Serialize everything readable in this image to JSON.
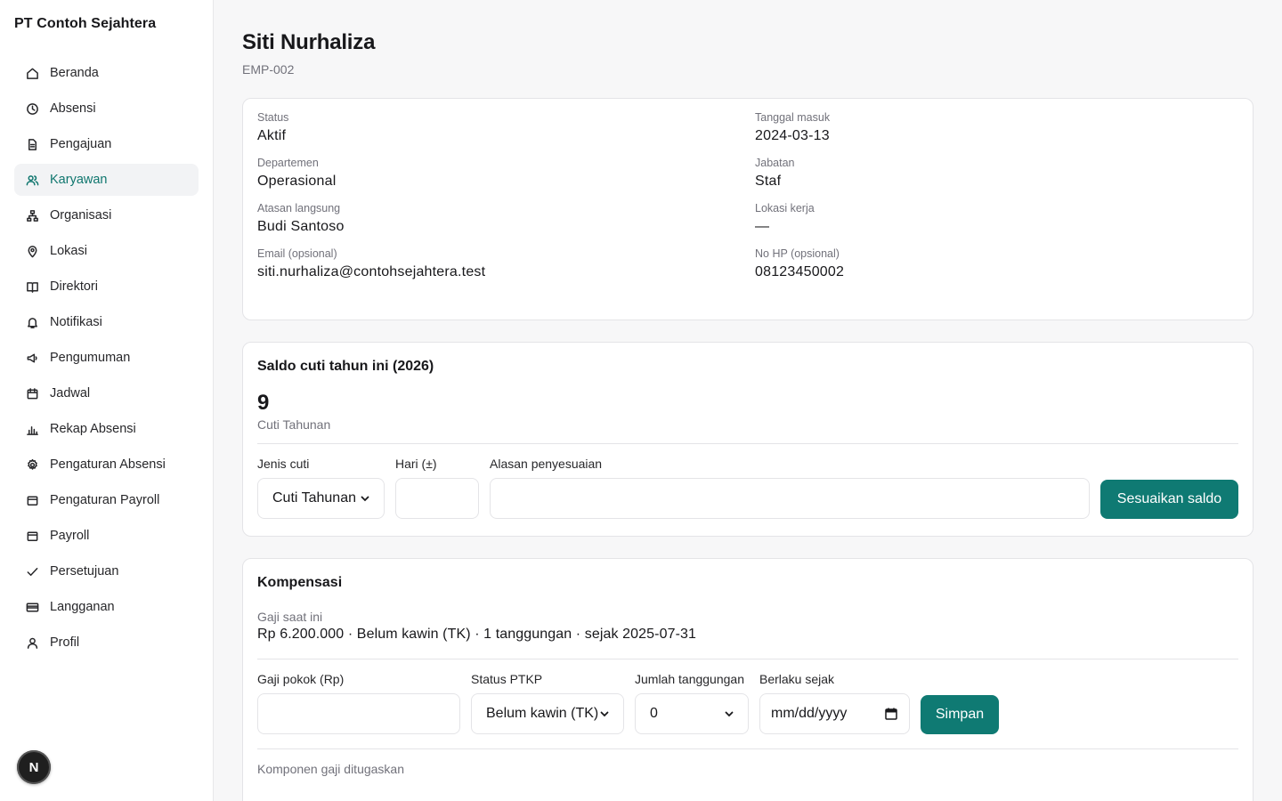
{
  "sidebar": {
    "company": "PT Contoh Sejahtera",
    "items": [
      {
        "label": "Beranda",
        "icon": "home-icon"
      },
      {
        "label": "Absensi",
        "icon": "clock-icon"
      },
      {
        "label": "Pengajuan",
        "icon": "file-icon"
      },
      {
        "label": "Karyawan",
        "icon": "users-icon",
        "active": true
      },
      {
        "label": "Organisasi",
        "icon": "org-chart-icon"
      },
      {
        "label": "Lokasi",
        "icon": "map-pin-icon"
      },
      {
        "label": "Direktori",
        "icon": "book-icon"
      },
      {
        "label": "Notifikasi",
        "icon": "bell-icon"
      },
      {
        "label": "Pengumuman",
        "icon": "megaphone-icon"
      },
      {
        "label": "Jadwal",
        "icon": "calendar-icon"
      },
      {
        "label": "Rekap Absensi",
        "icon": "bar-chart-icon"
      },
      {
        "label": "Pengaturan Absensi",
        "icon": "gear-icon"
      },
      {
        "label": "Pengaturan Payroll",
        "icon": "wallet-icon"
      },
      {
        "label": "Payroll",
        "icon": "wallet-icon"
      },
      {
        "label": "Persetujuan",
        "icon": "check-icon"
      },
      {
        "label": "Langganan",
        "icon": "credit-card-icon"
      },
      {
        "label": "Profil",
        "icon": "user-icon"
      }
    ],
    "badge": "N"
  },
  "employee": {
    "name": "Siti Nurhaliza",
    "id": "EMP-002"
  },
  "info": {
    "status_label": "Status",
    "status": "Aktif",
    "join_label": "Tanggal masuk",
    "join": "2024-03-13",
    "dept_label": "Departemen",
    "dept": "Operasional",
    "position_label": "Jabatan",
    "position": "Staf",
    "manager_label": "Atasan langsung",
    "manager": "Budi Santoso",
    "location_label": "Lokasi kerja",
    "location": "—",
    "email_label": "Email (opsional)",
    "email": "siti.nurhaliza@contohsejahtera.test",
    "phone_label": "No HP (opsional)",
    "phone": "08123450002"
  },
  "leave": {
    "title": "Saldo cuti tahun ini (2026)",
    "count": "9",
    "type": "Cuti Tahunan",
    "type_label": "Jenis cuti",
    "type_value": "Cuti Tahunan",
    "days_label": "Hari (±)",
    "days_value": "",
    "reason_label": "Alasan penyesuaian",
    "reason_value": "",
    "submit": "Sesuaikan saldo"
  },
  "compensation": {
    "title": "Kompensasi",
    "current_label": "Gaji saat ini",
    "current": "Rp 6.200.000 · Belum kawin (TK) · 1 tanggungan · sejak 2025-07-31",
    "salary_label": "Gaji pokok (Rp)",
    "salary_value": "",
    "ptkp_label": "Status PTKP",
    "ptkp_value": "Belum kawin (TK)",
    "dependents_label": "Jumlah tanggungan",
    "dependents_value": "0",
    "effective_label": "Berlaku sejak",
    "effective_placeholder": "mm/dd/yyyy",
    "save": "Simpan",
    "components_label": "Komponen gaji ditugaskan"
  },
  "colors": {
    "accent": "#0f7a73",
    "active_nav_text": "#0f766e"
  }
}
